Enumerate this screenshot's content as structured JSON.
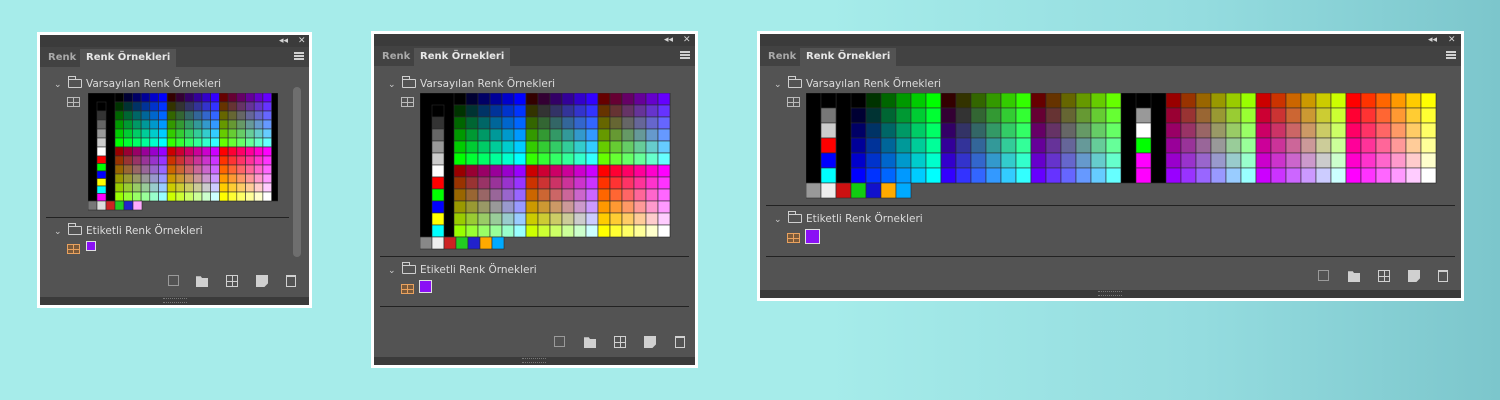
{
  "panel": {
    "tab_color": "Renk",
    "tab_swatches": "Renk Örnekleri",
    "collapse_icon": "double-chevron-left-icon",
    "close_icon": "close-icon",
    "menu_icon": "hamburger-menu-icon"
  },
  "groups": {
    "default": "Varsayılan Renk Örnekleri",
    "labeled": "Etiketli Renk Örnekleri"
  },
  "colors": {
    "background": "#535353",
    "selected_accent": "#e8a15e",
    "labeled_swatch": "#8a10f5"
  },
  "bottom_toolbar": [
    {
      "name": "new-color-group-icon"
    },
    {
      "name": "folder-icon"
    },
    {
      "name": "swatches-grid-icon"
    },
    {
      "name": "new-swatch-icon"
    },
    {
      "name": "trash-icon"
    }
  ]
}
